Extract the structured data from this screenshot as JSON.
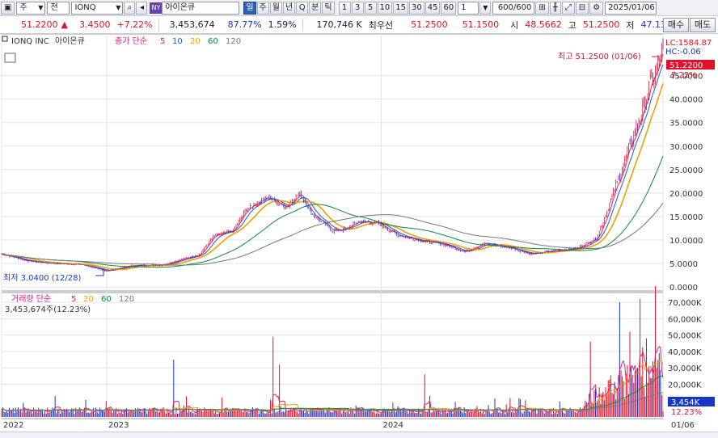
{
  "toolbar": {
    "period_select": "주",
    "mode_select": "전",
    "symbol": "IONQ",
    "exchange_badge": "NY",
    "name": "아이온큐",
    "periods": [
      "일",
      "주",
      "월",
      "년",
      "Q",
      "분",
      "틱"
    ],
    "active_period": "일",
    "intervals": [
      "1",
      "3",
      "5",
      "10",
      "15",
      "30",
      "45",
      "60"
    ],
    "interval_value": "1",
    "count": "600/600",
    "date": "2025/01/06"
  },
  "quote": {
    "price": "51.2200",
    "change_arrow": "▲",
    "change": "3.4500",
    "change_pct": "+7.22%",
    "volume": "3,453,674",
    "pct1": "87.77%",
    "pct2": "1.59%",
    "amount": "170,746 K",
    "best_ask_label": "최우선",
    "best_ask": "51.2500",
    "best_bid": "51.1500",
    "open_label": "시",
    "open": "48.5662",
    "high_label": "고",
    "high": "51.2500",
    "low_label": "저",
    "low": "47.1342",
    "buy_label": "매수",
    "sell_label": "매도"
  },
  "price_panel": {
    "name": "IONQ INC",
    "name_kr": "아이온큐",
    "ma_label": "종가 단순",
    "ma_periods": [
      "5",
      "10",
      "20",
      "60",
      "120"
    ],
    "ma_colors": [
      "#e0206f",
      "#1f57d6",
      "#f0a000",
      "#0b8a3a",
      "#777777"
    ],
    "lc": "LC:1584.87",
    "hc": "HC:-0.06",
    "high_annotation": "최고 51.2500 (01/06)",
    "low_annotation": "최저 3.0400 (12/28)",
    "current_price_tag": "51.2200",
    "current_pct_tag": "7.22%"
  },
  "volume_panel": {
    "ma_label": "거래량 단순",
    "ma_periods": [
      "5",
      "20",
      "60",
      "120"
    ],
    "ma_colors": [
      "#e0206f",
      "#f0a000",
      "#0b8a3a",
      "#777777"
    ],
    "volume_info": "3,453,674주(12.23%)",
    "current_volume_tag": "3,454K",
    "current_pct_tag": "12.23%"
  },
  "chart_data": {
    "type": "candlestick",
    "price_axis": {
      "ticks": [
        0,
        5000,
        10000,
        15000,
        20000,
        25000,
        30000,
        35000,
        40000,
        45000
      ],
      "labels": [
        "0.0000",
        "5.0000",
        "10.0000",
        "15.0000",
        "20.0000",
        "25.0000",
        "30.0000",
        "35.0000",
        "40.0000",
        "45.0000"
      ],
      "range": [
        -0.5,
        52.5
      ]
    },
    "volume_axis": {
      "ticks": [
        20000,
        30000,
        40000,
        50000,
        60000,
        70000
      ],
      "labels": [
        "20,000K",
        "30,000K",
        "40,000K",
        "50,000K",
        "60,000K",
        "70,000K"
      ],
      "range": [
        0,
        74000
      ]
    },
    "x_labels": [
      {
        "label": "2022",
        "pos": 0.0
      },
      {
        "label": "2023",
        "pos": 0.159
      },
      {
        "label": "2024",
        "pos": 0.574
      },
      {
        "label": "01/06",
        "pos": 1.0
      }
    ],
    "close_keypoints": [
      [
        0.0,
        7.0
      ],
      [
        0.04,
        5.5
      ],
      [
        0.08,
        5.0
      ],
      [
        0.12,
        4.8
      ],
      [
        0.156,
        3.4
      ],
      [
        0.2,
        4.6
      ],
      [
        0.24,
        4.6
      ],
      [
        0.28,
        6.2
      ],
      [
        0.3,
        7.0
      ],
      [
        0.32,
        10.8
      ],
      [
        0.35,
        12.0
      ],
      [
        0.37,
        16.5
      ],
      [
        0.4,
        19.2
      ],
      [
        0.43,
        17.0
      ],
      [
        0.45,
        20.0
      ],
      [
        0.47,
        15.5
      ],
      [
        0.5,
        12.0
      ],
      [
        0.52,
        12.3
      ],
      [
        0.54,
        14.0
      ],
      [
        0.57,
        13.5
      ],
      [
        0.6,
        11.0
      ],
      [
        0.63,
        10.0
      ],
      [
        0.67,
        9.0
      ],
      [
        0.7,
        7.5
      ],
      [
        0.73,
        9.3
      ],
      [
        0.77,
        8.3
      ],
      [
        0.8,
        7.0
      ],
      [
        0.84,
        7.8
      ],
      [
        0.87,
        8.2
      ],
      [
        0.9,
        10.5
      ],
      [
        0.92,
        18.0
      ],
      [
        0.94,
        26.0
      ],
      [
        0.96,
        34.0
      ],
      [
        0.97,
        38.0
      ],
      [
        0.98,
        43.0
      ],
      [
        0.99,
        46.0
      ],
      [
        1.0,
        51.22
      ]
    ],
    "volume_spikes": [
      [
        0.26,
        35000
      ],
      [
        0.41,
        49000
      ],
      [
        0.42,
        32000
      ],
      [
        0.64,
        26000
      ],
      [
        0.89,
        46000
      ],
      [
        0.935,
        70000
      ],
      [
        0.95,
        52000
      ],
      [
        0.975,
        48000
      ]
    ]
  }
}
